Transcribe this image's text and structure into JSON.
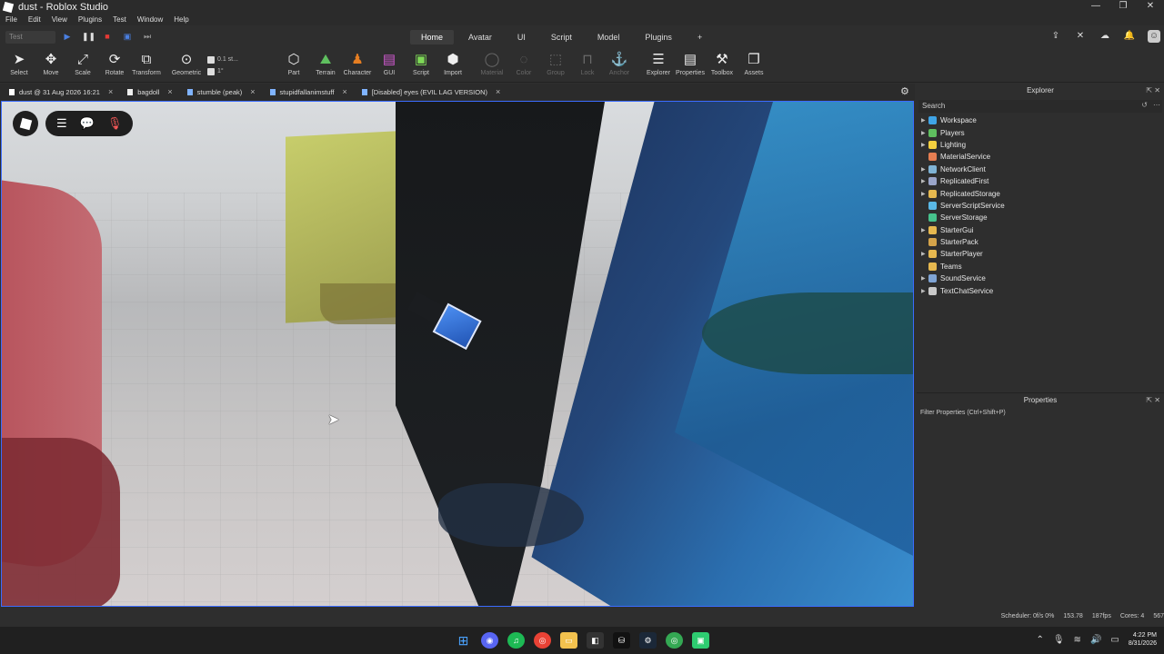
{
  "window": {
    "title": "dust - Roblox Studio",
    "controls": [
      "—",
      "❐",
      "✕"
    ]
  },
  "menu": [
    "File",
    "Edit",
    "View",
    "Plugins",
    "Test",
    "Window",
    "Help"
  ],
  "ribbon": {
    "test_select": "Test",
    "tabs": [
      "Home",
      "Avatar",
      "UI",
      "Script",
      "Model",
      "Plugins",
      "+"
    ],
    "active_tab": "Home"
  },
  "toolbar": {
    "select": "Select",
    "move": "Move",
    "scale": "Scale",
    "rotate": "Rotate",
    "transform": "Transform",
    "geometric": "Geometric",
    "snap_move": "0.1 st...",
    "snap_rotate": "1°",
    "part": "Part",
    "terrain": "Terrain",
    "character": "Character",
    "gui": "GUI",
    "script": "Script",
    "import": "Import",
    "material": "Material",
    "color": "Color",
    "group": "Group",
    "lock": "Lock",
    "anchor": "Anchor",
    "explorer": "Explorer",
    "properties": "Properties",
    "toolbox": "Toolbox",
    "assets": "Assets"
  },
  "doc_tabs": [
    {
      "label": "dust @ 31 Aug 2026 16:21"
    },
    {
      "label": "bagdoll"
    },
    {
      "label": "stumble (peak)"
    },
    {
      "label": "stupidfallanimstuff"
    },
    {
      "label": "[Disabled] eyes (EVIL LAG VERSION)"
    }
  ],
  "explorer": {
    "title": "Explorer",
    "search": "Search",
    "items": [
      {
        "label": "Workspace",
        "color": "#3fa4e6",
        "expandable": true
      },
      {
        "label": "Players",
        "color": "#5fbf5f",
        "expandable": true
      },
      {
        "label": "Lighting",
        "color": "#f4d03f",
        "expandable": true
      },
      {
        "label": "MaterialService",
        "color": "#e67e52",
        "expandable": false
      },
      {
        "label": "NetworkClient",
        "color": "#7fb3d5",
        "expandable": true
      },
      {
        "label": "ReplicatedFirst",
        "color": "#9aa5c9",
        "expandable": true
      },
      {
        "label": "ReplicatedStorage",
        "color": "#e6b84f",
        "expandable": true
      },
      {
        "label": "ServerScriptService",
        "color": "#5ab8e6",
        "expandable": false
      },
      {
        "label": "ServerStorage",
        "color": "#46c28c",
        "expandable": false
      },
      {
        "label": "StarterGui",
        "color": "#e6b84f",
        "expandable": true
      },
      {
        "label": "StarterPack",
        "color": "#d4a34a",
        "expandable": false
      },
      {
        "label": "StarterPlayer",
        "color": "#e6b84f",
        "expandable": true
      },
      {
        "label": "Teams",
        "color": "#e6b84f",
        "expandable": false
      },
      {
        "label": "SoundService",
        "color": "#7fa4d5",
        "expandable": true
      },
      {
        "label": "TextChatService",
        "color": "#c9c9c9",
        "expandable": true
      }
    ]
  },
  "properties": {
    "title": "Properties",
    "filter": "Filter Properties (Ctrl+Shift+P)"
  },
  "status": {
    "scheduler": "Scheduler: 0f/s 0%",
    "mem": "153.78",
    "fps": "187fps",
    "cores": "Cores: 4",
    "extra": "567"
  },
  "taskbar": {
    "time": "4:22 PM",
    "date": "8/31/2026"
  }
}
